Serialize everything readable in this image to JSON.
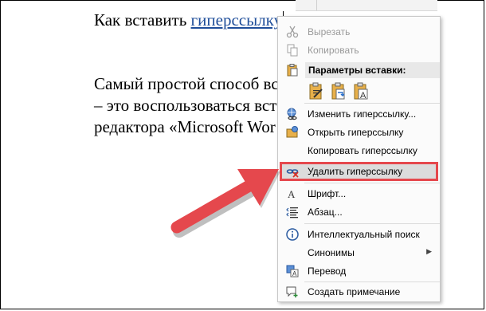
{
  "document": {
    "line1_prefix": "Как вставить ",
    "line1_link": "гиперссылку",
    "line2": "Самый простой способ вс                      окумен",
    "line3": "– это воспользоваться вст                      тами те",
    "line4": "редактора «Microsoft Wor"
  },
  "context_menu": {
    "cut": "Вырезать",
    "copy": "Копировать",
    "paste_options_title": "Параметры вставки:",
    "edit_link": "Изменить гиперссылку...",
    "open_link": "Открыть гиперссылку",
    "copy_link": "Копировать гиперссылку",
    "remove_link": "Удалить гиперссылку",
    "font": "Шрифт...",
    "paragraph": "Абзац...",
    "smart_lookup": "Интеллектуальный поиск",
    "synonyms": "Синонимы",
    "translate": "Перевод",
    "new_comment": "Создать примечание"
  },
  "colors": {
    "highlight_border": "#e5484d",
    "arrow": "#e5484d",
    "link": "#1f4e9a"
  }
}
